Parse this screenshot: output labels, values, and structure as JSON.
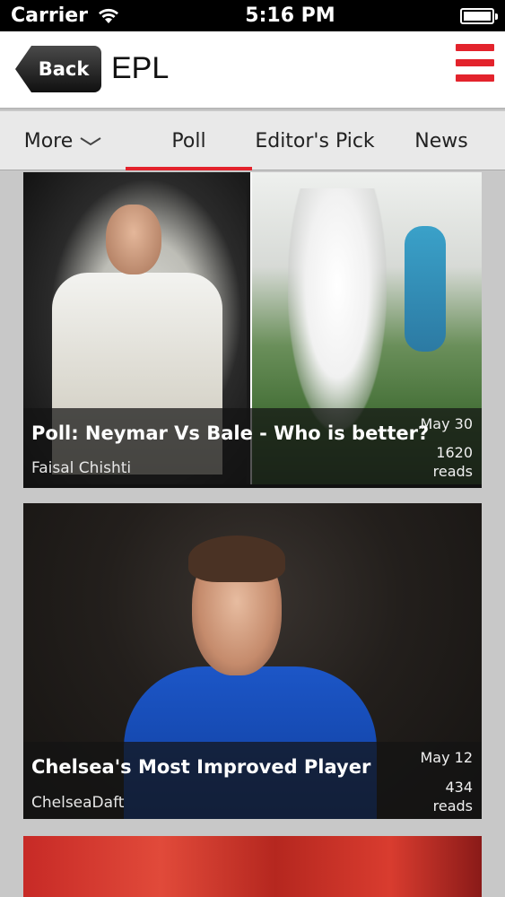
{
  "status_bar": {
    "carrier": "Carrier",
    "time": "5:16 PM"
  },
  "header": {
    "back_label": "Back",
    "title": "EPL"
  },
  "tabs": {
    "more": "More",
    "poll": "Poll",
    "editors_pick": "Editor's Pick",
    "news": "News",
    "selected": "Poll"
  },
  "colors": {
    "accent": "#e3232c"
  },
  "articles": [
    {
      "title": "Poll: Neymar Vs Bale - Who is better?",
      "author": "Faisal Chishti",
      "date": "May 30",
      "reads_count": "1620",
      "reads_label": "reads"
    },
    {
      "title": "Chelsea's Most Improved Player",
      "author": "ChelseaDaft",
      "date": "May 12",
      "reads_count": "434",
      "reads_label": "reads"
    }
  ]
}
